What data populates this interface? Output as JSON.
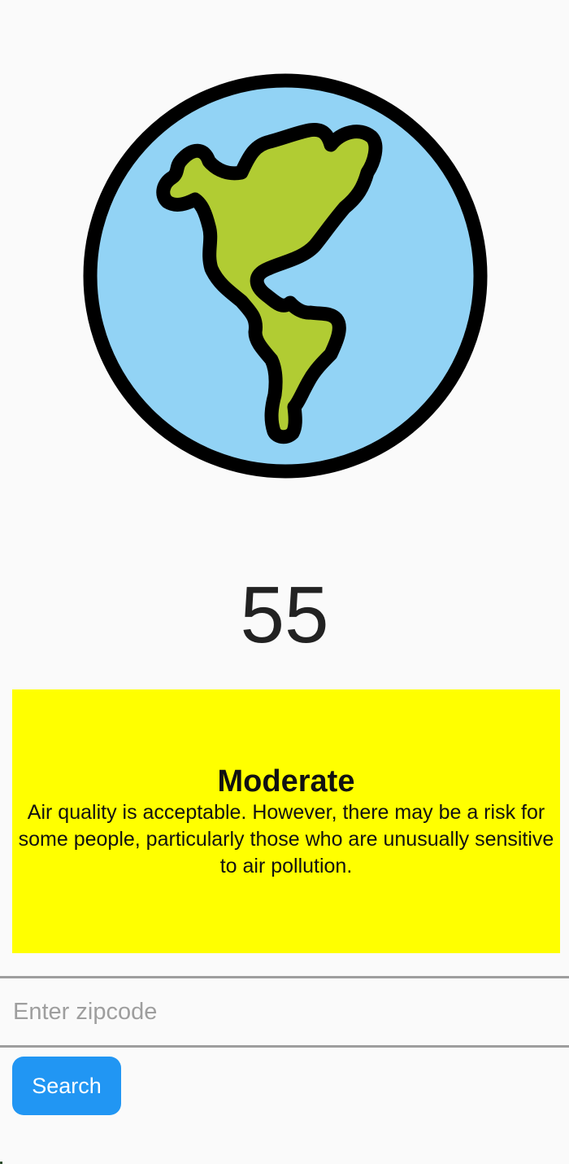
{
  "globe": {
    "icon": "earth-americas-icon"
  },
  "aqi": {
    "value": "55"
  },
  "status": {
    "level": "Moderate",
    "description": "Air quality is acceptable. However, there may be a risk for some people, particularly those who are unusually sensitive to air pollution.",
    "color": "#ffff00"
  },
  "zipcode": {
    "value": "",
    "placeholder": "Enter zipcode"
  },
  "search": {
    "label": "Search",
    "color": "#2196f3"
  },
  "colors": {
    "ocean": "#92d3f5",
    "land": "#b1cc33",
    "outline": "#000000"
  }
}
